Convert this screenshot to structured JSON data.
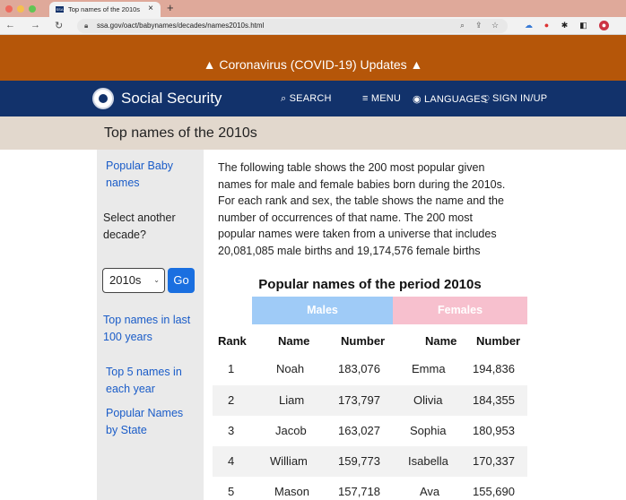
{
  "browser": {
    "tab_title": "Top names of the 2010s",
    "tab_close": "×",
    "new_tab": "+",
    "url": "ssa.gov/oact/babynames/decades/names2010s.html",
    "favicon_text": "SSA",
    "traffic_lights": [
      "#ed6a5e",
      "#f5bf4f",
      "#61c554"
    ]
  },
  "banner": {
    "covid": "▲ Coronavirus (COVID-19) Updates ▲",
    "color": "#b55609"
  },
  "header": {
    "brand": "Social Security",
    "nav": [
      "⌕ SEARCH",
      "≡ MENU",
      "◉ LANGUAGES",
      "⍜ SIGN IN/UP"
    ],
    "color": "#12326b"
  },
  "page": {
    "title": "Top names of the 2010s"
  },
  "sidebar": {
    "popular_baby_names": [
      "Popular Baby",
      "names"
    ],
    "select_prompt": [
      "Select another",
      "decade?"
    ],
    "decade_value": "2010s",
    "go_label": "Go",
    "top_100": [
      "Top names in last",
      "100 years"
    ],
    "top5": [
      "Top 5 names in",
      "each year"
    ],
    "by_state": [
      "Popular Names",
      "by State"
    ]
  },
  "intro": {
    "lines": [
      "The following table shows the 200 most popular given",
      "names for male and female babies born during the 2010s.",
      "For each rank and sex, the table shows the name and the",
      "number of occurrences of that name. The 200 most",
      "popular names were taken from a universe that includes",
      "20,081,085 male births and 19,174,576 female births"
    ]
  },
  "table": {
    "title": "Popular names of the period 2010s",
    "males_header": "Males",
    "females_header": "Females",
    "columns": [
      "Rank",
      "Name",
      "Number",
      "Name",
      "Number"
    ],
    "rows": [
      [
        "1",
        "Noah",
        "183,076",
        "Emma",
        "194,836"
      ],
      [
        "2",
        "Liam",
        "173,797",
        "Olivia",
        "184,355"
      ],
      [
        "3",
        "Jacob",
        "163,027",
        "Sophia",
        "180,953"
      ],
      [
        "4",
        "William",
        "159,773",
        "Isabella",
        "170,337"
      ],
      [
        "5",
        "Mason",
        "157,718",
        "Ava",
        "155,690"
      ]
    ]
  }
}
